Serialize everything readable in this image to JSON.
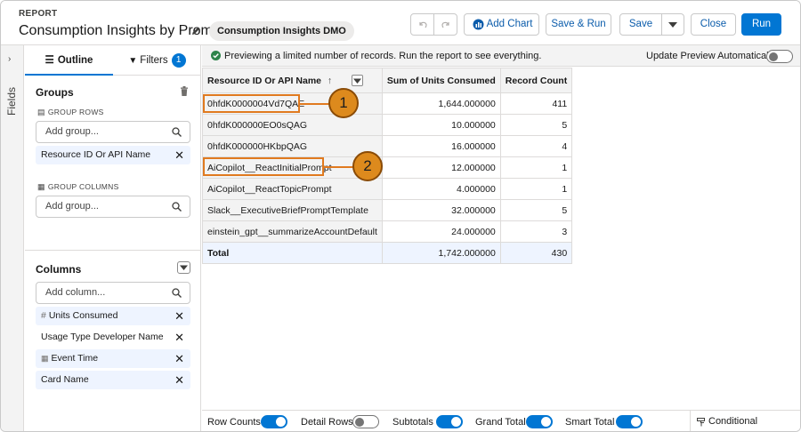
{
  "header": {
    "report_label": "REPORT",
    "title": "Consumption Insights by Prompt",
    "dmo_pill": "Consumption Insights DMO",
    "buttons": {
      "add_chart": "Add Chart",
      "save_run": "Save & Run",
      "save": "Save",
      "close": "Close",
      "run": "Run"
    }
  },
  "rail": {
    "label": "Fields"
  },
  "panel": {
    "tabs": {
      "outline": "Outline",
      "filters": "Filters",
      "filters_count": "1"
    },
    "groups": {
      "title": "Groups",
      "group_rows_label": "GROUP ROWS",
      "group_rows_placeholder": "Add group...",
      "group_rows_items": [
        "Resource ID Or API Name"
      ],
      "group_columns_label": "GROUP COLUMNS",
      "group_columns_placeholder": "Add group..."
    },
    "columns": {
      "title": "Columns",
      "placeholder": "Add column...",
      "items": [
        "Units Consumed",
        "Usage Type Developer Name",
        "Event Time",
        "Card Name"
      ]
    }
  },
  "main": {
    "info_message": "Previewing a limited number of records. Run the report to see everything.",
    "update_preview_label": "Update Preview Automatically",
    "update_preview_on": false,
    "table": {
      "headers": [
        "Resource ID Or API Name",
        "Sum of Units Consumed",
        "Record Count"
      ],
      "sort_indicator": "↑",
      "rows": [
        [
          "0hfdK0000004Vd7QAE",
          "1,644.000000",
          "411"
        ],
        [
          "0hfdK000000EO0sQAG",
          "10.000000",
          "5"
        ],
        [
          "0hfdK000000HKbpQAG",
          "16.000000",
          "4"
        ],
        [
          "AiCopilot__ReactInitialPrompt",
          "12.000000",
          "1"
        ],
        [
          "AiCopilot__ReactTopicPrompt",
          "4.000000",
          "1"
        ],
        [
          "Slack__ExecutiveBriefPromptTemplate",
          "32.000000",
          "5"
        ],
        [
          "einstein_gpt__summarizeAccountDefault",
          "24.000000",
          "3"
        ]
      ],
      "total": [
        "Total",
        "1,742.000000",
        "430"
      ]
    },
    "callouts": [
      "1",
      "2"
    ]
  },
  "footer": {
    "row_counts": "Row Counts",
    "detail_rows": "Detail Rows",
    "subtotals": "Subtotals",
    "grand_total": "Grand Total",
    "smart_total": "Smart Total",
    "conditional_formatting": "Conditional Formatting",
    "toggles": {
      "row_counts": true,
      "detail_rows": false,
      "subtotals": true,
      "grand_total": true,
      "smart_total": true
    }
  },
  "colors": {
    "brand": "#0176d3",
    "callout": "#e07a1f",
    "success": "#2e844a"
  }
}
